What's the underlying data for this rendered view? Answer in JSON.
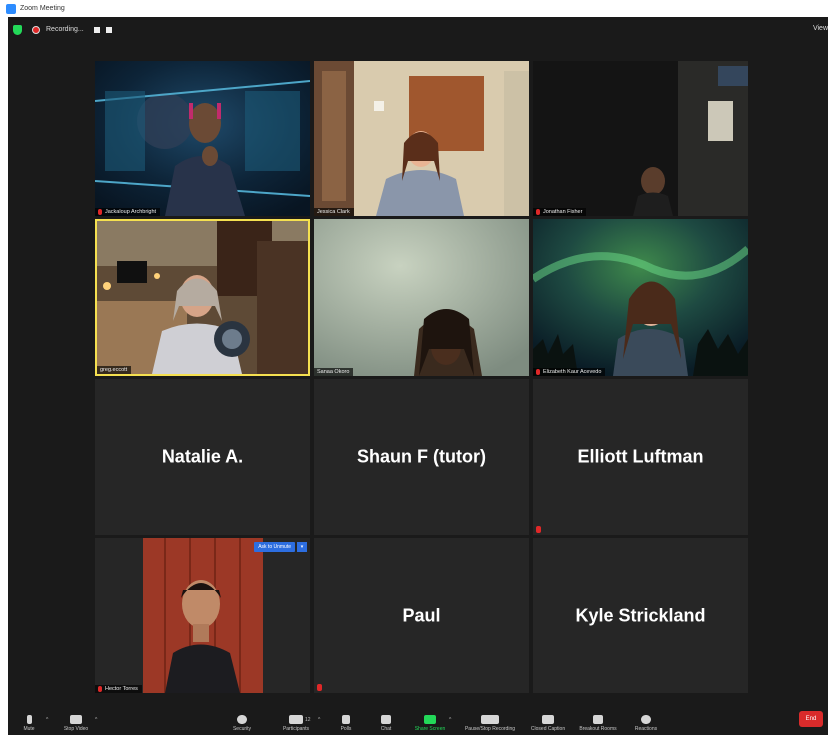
{
  "window": {
    "title": "Zoom Meeting"
  },
  "topbar": {
    "recording_label": "Recording...",
    "view_label": "View"
  },
  "participants": [
    {
      "name": "Jackaloup Archbright",
      "muted": true,
      "video": true
    },
    {
      "name": "Jessica Clark",
      "muted": false,
      "video": true
    },
    {
      "name": "Jonathan Fisher",
      "muted": true,
      "video": true
    },
    {
      "name": "greg.eccott",
      "muted": false,
      "video": true,
      "speaking": true
    },
    {
      "name": "Sanaa Okoro",
      "muted": false,
      "video": true
    },
    {
      "name": "Elizabeth Kaur Acevedo",
      "muted": true,
      "video": true
    },
    {
      "name": "Natalie A.",
      "muted": false,
      "video": false
    },
    {
      "name": "Shaun F (tutor)",
      "muted": false,
      "video": false
    },
    {
      "name": "Elliott Luftman",
      "muted": true,
      "video": false
    },
    {
      "name": "Hector Torres",
      "muted": true,
      "video": true
    },
    {
      "name": "Paul",
      "muted": true,
      "video": false
    },
    {
      "name": "Kyle Strickland",
      "muted": false,
      "video": false
    }
  ],
  "ask_to_unmute": {
    "label": "Ask to Unmute"
  },
  "toolbar": {
    "mute": "Mute",
    "stop_video": "Stop Video",
    "security": "Security",
    "participants": "Participants",
    "participants_count": "12",
    "polls": "Polls",
    "chat": "Chat",
    "share_screen": "Share Screen",
    "pause_recording": "Pause/Stop Recording",
    "closed_caption": "Closed Caption",
    "breakout_rooms": "Breakout Rooms",
    "reactions": "Reactions",
    "end": "End"
  },
  "colors": {
    "share_green": "#23d959",
    "end_red": "#d92b2b",
    "speaker_border": "#f5e050",
    "accent_blue": "#2d6ee0"
  }
}
